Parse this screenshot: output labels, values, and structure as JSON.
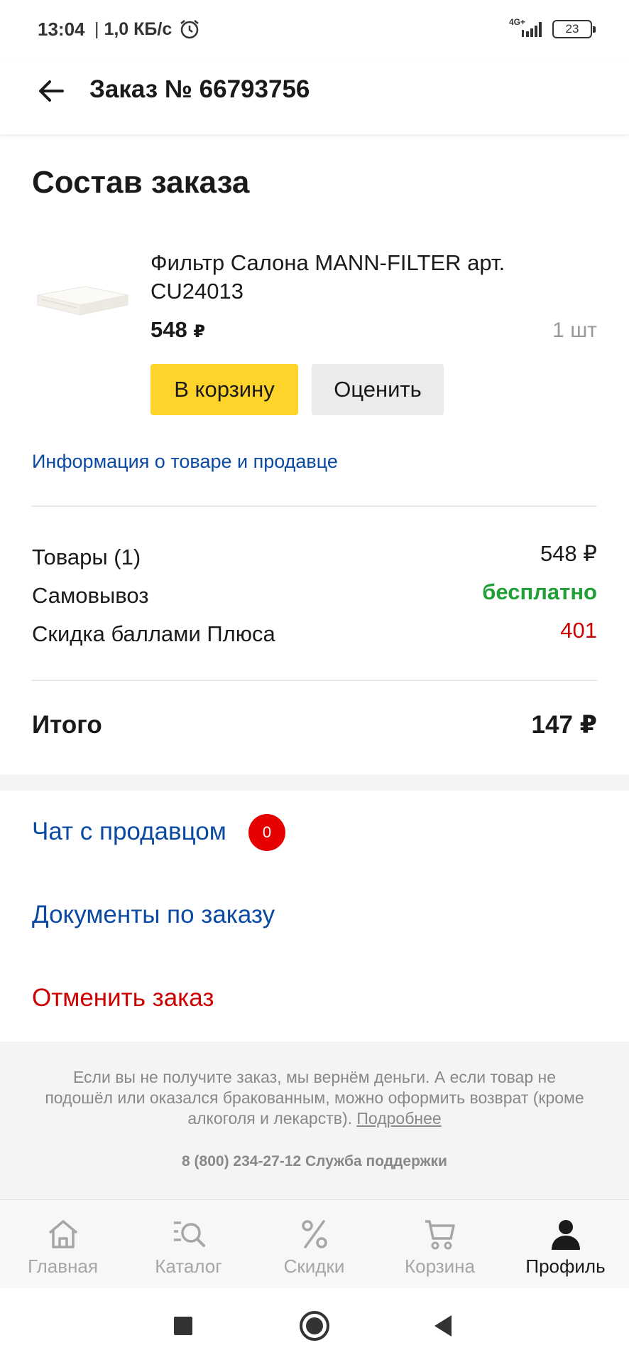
{
  "status_bar": {
    "time": "13:04",
    "separator": "|",
    "speed": "1,0 КБ/с",
    "network": "4G+",
    "battery": "23"
  },
  "header": {
    "title": "Заказ № 66793756"
  },
  "order": {
    "section_title": "Состав заказа",
    "item": {
      "name": "Фильтр Салона MANN-FILTER арт. CU24013",
      "price": "548",
      "currency": "₽",
      "quantity": "1 шт",
      "add_to_cart_label": "В корзину",
      "rate_label": "Оценить"
    },
    "info_link": "Информация о товаре и продавце"
  },
  "summary": {
    "goods_label": "Товары (1)",
    "goods_value": "548 ₽",
    "pickup_label": "Самовывоз",
    "pickup_value": "бесплатно",
    "discount_label": "Скидка баллами Плюса",
    "discount_value": "401",
    "total_label": "Итого",
    "total_value": "147 ₽"
  },
  "actions": {
    "chat_label": "Чат с продавцом",
    "chat_badge": "0",
    "documents_label": "Документы по заказу",
    "cancel_label": "Отменить заказ"
  },
  "footer": {
    "refund_text": "Если вы не получите заказ, мы вернём деньги. А если товар не подошёл или оказался бракованным, можно оформить возврат (кроме алкоголя и лекарств).",
    "more_link": "Подробнее",
    "support_phone": "8 (800) 234-27-12 Служба поддержки"
  },
  "tabbar": {
    "tabs": [
      {
        "label": "Главная",
        "icon": "home-icon"
      },
      {
        "label": "Каталог",
        "icon": "catalog-icon"
      },
      {
        "label": "Скидки",
        "icon": "percent-icon"
      },
      {
        "label": "Корзина",
        "icon": "cart-icon"
      },
      {
        "label": "Профиль",
        "icon": "profile-icon"
      }
    ],
    "active": "Профиль"
  },
  "colors": {
    "accent_yellow": "#fed42b",
    "link_blue": "#0b4aa2",
    "free_green": "#21a038",
    "discount_red": "#cc0000",
    "cancel_red": "#cc0000",
    "badge_red": "#e60000"
  }
}
